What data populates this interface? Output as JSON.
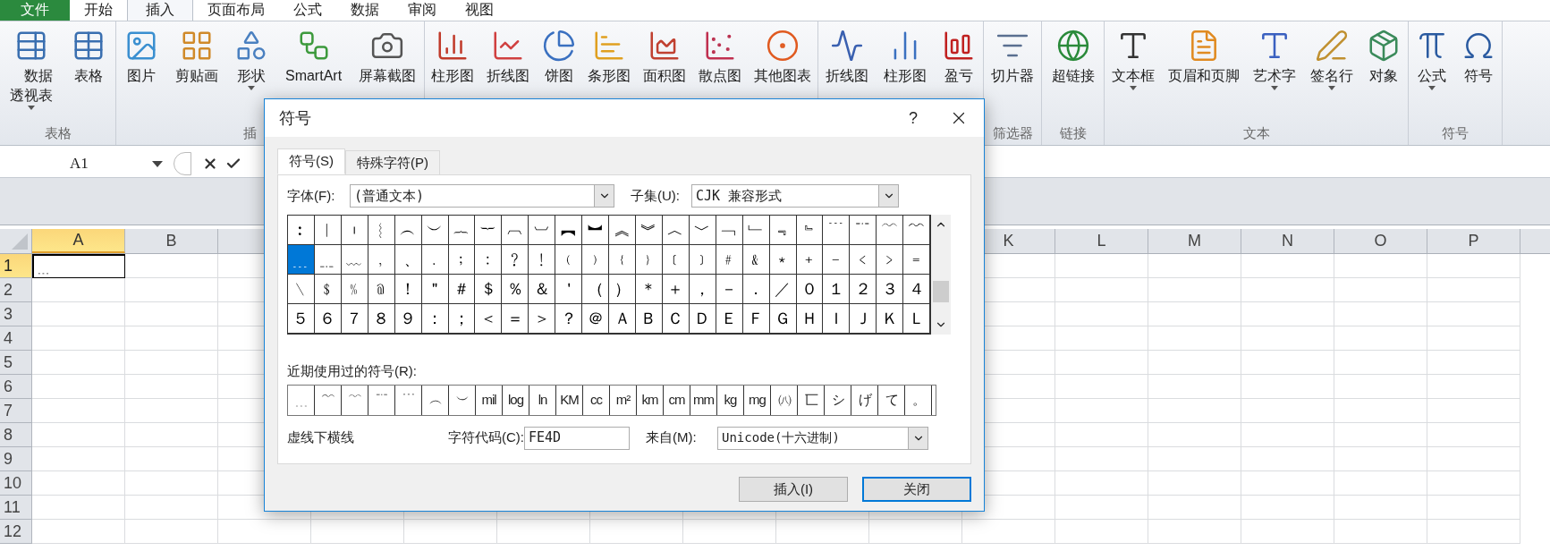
{
  "ribbon_tabs": [
    {
      "label": "文件",
      "kind": "file",
      "selected": false
    },
    {
      "label": "开始",
      "kind": "tab",
      "selected": false
    },
    {
      "label": "插入",
      "kind": "tab",
      "selected": true
    },
    {
      "label": "页面布局",
      "kind": "tab",
      "selected": false
    },
    {
      "label": "公式",
      "kind": "tab",
      "selected": false
    },
    {
      "label": "数据",
      "kind": "tab",
      "selected": false
    },
    {
      "label": "审阅",
      "kind": "tab",
      "selected": false
    },
    {
      "label": "视图",
      "kind": "tab",
      "selected": false
    }
  ],
  "ribbon_groups": [
    {
      "label": "表格",
      "items": [
        {
          "label": "数据透视表",
          "dropdown": true
        },
        {
          "label": "表格",
          "dropdown": false
        }
      ]
    },
    {
      "label": "插",
      "items": [
        {
          "label": "图片",
          "dropdown": false
        },
        {
          "label": "剪贴画",
          "dropdown": false
        },
        {
          "label": "形状",
          "dropdown": true
        },
        {
          "label": "SmartArt",
          "dropdown": false
        },
        {
          "label": "屏幕截图",
          "dropdown": false
        }
      ]
    },
    {
      "items": [
        {
          "label": "柱形图",
          "dropdown": false
        },
        {
          "label": "折线图",
          "dropdown": false
        },
        {
          "label": "饼图",
          "dropdown": false
        },
        {
          "label": "条形图",
          "dropdown": false
        },
        {
          "label": "面积图",
          "dropdown": false
        },
        {
          "label": "散点图",
          "dropdown": false
        },
        {
          "label": "其他图表",
          "dropdown": false
        }
      ]
    },
    {
      "items": [
        {
          "label": "折线图",
          "dropdown": false
        },
        {
          "label": "柱形图",
          "dropdown": false
        },
        {
          "label": "盈亏",
          "dropdown": false
        }
      ]
    },
    {
      "label": "筛选器",
      "items": [
        {
          "label": "切片器",
          "dropdown": false
        }
      ]
    },
    {
      "label": "链接",
      "items": [
        {
          "label": "超链接",
          "dropdown": false
        }
      ]
    },
    {
      "label": "文本",
      "items": [
        {
          "label": "文本框",
          "dropdown": true
        },
        {
          "label": "页眉和页脚",
          "dropdown": false
        },
        {
          "label": "艺术字",
          "dropdown": true
        },
        {
          "label": "签名行",
          "dropdown": true
        },
        {
          "label": "对象",
          "dropdown": false
        }
      ]
    },
    {
      "label": "符号",
      "items": [
        {
          "label": "公式",
          "dropdown": true
        },
        {
          "label": "符号",
          "dropdown": false
        }
      ]
    }
  ],
  "name_box": "A1",
  "sheet": {
    "columns_left": [
      {
        "label": "A",
        "selected": true
      },
      {
        "label": "B",
        "selected": false
      }
    ],
    "columns_right": [
      {
        "label": "K",
        "selected": false
      },
      {
        "label": "L",
        "selected": false
      },
      {
        "label": "M",
        "selected": false
      },
      {
        "label": "N",
        "selected": false
      },
      {
        "label": "O",
        "selected": false
      },
      {
        "label": "P",
        "selected": false
      }
    ],
    "rows": [
      {
        "label": "1",
        "selected": true,
        "cell_a": "﹍"
      },
      {
        "label": "2",
        "selected": false
      },
      {
        "label": "3",
        "selected": false
      },
      {
        "label": "4",
        "selected": false
      },
      {
        "label": "5",
        "selected": false
      },
      {
        "label": "6",
        "selected": false
      },
      {
        "label": "7",
        "selected": false
      },
      {
        "label": "8",
        "selected": false
      },
      {
        "label": "9",
        "selected": false
      },
      {
        "label": "10",
        "selected": false
      },
      {
        "label": "11",
        "selected": false
      },
      {
        "label": "12",
        "selected": false
      }
    ]
  },
  "dialog": {
    "title": "符号",
    "help": "?",
    "tabs": [
      {
        "label": "符号(S)",
        "selected": true
      },
      {
        "label": "特殊字符(P)",
        "selected": false
      }
    ],
    "font_label": "字体(F):",
    "font_value": "(普通文本)",
    "subset_label": "子集(U):",
    "subset_value": "CJK 兼容形式",
    "symbol_rows": [
      [
        {
          "char": "︰",
          "selected": false
        },
        {
          "char": "︱",
          "selected": false
        },
        {
          "char": "︲",
          "selected": false
        },
        {
          "char": "︴",
          "selected": false
        },
        {
          "char": "︵",
          "selected": false
        },
        {
          "char": "︶",
          "selected": false
        },
        {
          "char": "︷",
          "selected": false
        },
        {
          "char": "︸",
          "selected": false
        },
        {
          "char": "︹",
          "selected": false
        },
        {
          "char": "︺",
          "selected": false
        },
        {
          "char": "︻",
          "selected": false
        },
        {
          "char": "︼",
          "selected": false
        },
        {
          "char": "︽",
          "selected": false
        },
        {
          "char": "︾",
          "selected": false
        },
        {
          "char": "︿",
          "selected": false
        },
        {
          "char": "﹀",
          "selected": false
        },
        {
          "char": "﹁",
          "selected": false
        },
        {
          "char": "﹂",
          "selected": false
        },
        {
          "char": "﹃",
          "selected": false
        },
        {
          "char": "﹄",
          "selected": false
        },
        {
          "char": "﹉",
          "selected": false
        },
        {
          "char": "﹊",
          "selected": false
        },
        {
          "char": "﹋",
          "selected": false
        },
        {
          "char": "﹌",
          "selected": false
        }
      ],
      [
        {
          "char": "﹍",
          "selected": true
        },
        {
          "char": "﹎",
          "selected": false
        },
        {
          "char": "﹏",
          "selected": false
        },
        {
          "char": "﹐",
          "selected": false
        },
        {
          "char": "﹑",
          "selected": false
        },
        {
          "char": "﹒",
          "selected": false
        },
        {
          "char": "﹔",
          "selected": false
        },
        {
          "char": "﹕",
          "selected": false
        },
        {
          "char": "﹖",
          "selected": false
        },
        {
          "char": "﹗",
          "selected": false
        },
        {
          "char": "﹙",
          "selected": false
        },
        {
          "char": "﹚",
          "selected": false
        },
        {
          "char": "﹛",
          "selected": false
        },
        {
          "char": "﹜",
          "selected": false
        },
        {
          "char": "﹝",
          "selected": false
        },
        {
          "char": "﹞",
          "selected": false
        },
        {
          "char": "﹟",
          "selected": false
        },
        {
          "char": "﹠",
          "selected": false
        },
        {
          "char": "﹡",
          "selected": false
        },
        {
          "char": "﹢",
          "selected": false
        },
        {
          "char": "﹣",
          "selected": false
        },
        {
          "char": "﹤",
          "selected": false
        },
        {
          "char": "﹥",
          "selected": false
        },
        {
          "char": "﹦",
          "selected": false
        }
      ],
      [
        {
          "char": "﹨",
          "selected": false
        },
        {
          "char": "﹩",
          "selected": false
        },
        {
          "char": "﹪",
          "selected": false
        },
        {
          "char": "﹫",
          "selected": false
        },
        {
          "char": "！",
          "selected": false
        },
        {
          "char": "＂",
          "selected": false
        },
        {
          "char": "＃",
          "selected": false
        },
        {
          "char": "＄",
          "selected": false
        },
        {
          "char": "％",
          "selected": false
        },
        {
          "char": "＆",
          "selected": false
        },
        {
          "char": "＇",
          "selected": false
        },
        {
          "char": "（",
          "selected": false
        },
        {
          "char": "）",
          "selected": false
        },
        {
          "char": "＊",
          "selected": false
        },
        {
          "char": "＋",
          "selected": false
        },
        {
          "char": "，",
          "selected": false
        },
        {
          "char": "－",
          "selected": false
        },
        {
          "char": "．",
          "selected": false
        },
        {
          "char": "／",
          "selected": false
        },
        {
          "char": "０",
          "selected": false
        },
        {
          "char": "１",
          "selected": false
        },
        {
          "char": "２",
          "selected": false
        },
        {
          "char": "３",
          "selected": false
        },
        {
          "char": "４",
          "selected": false
        }
      ],
      [
        {
          "char": "５",
          "selected": false
        },
        {
          "char": "６",
          "selected": false
        },
        {
          "char": "７",
          "selected": false
        },
        {
          "char": "８",
          "selected": false
        },
        {
          "char": "９",
          "selected": false
        },
        {
          "char": "：",
          "selected": false
        },
        {
          "char": "；",
          "selected": false
        },
        {
          "char": "＜",
          "selected": false
        },
        {
          "char": "＝",
          "selected": false
        },
        {
          "char": "＞",
          "selected": false
        },
        {
          "char": "？",
          "selected": false
        },
        {
          "char": "＠",
          "selected": false
        },
        {
          "char": "Ａ",
          "selected": false
        },
        {
          "char": "Ｂ",
          "selected": false
        },
        {
          "char": "Ｃ",
          "selected": false
        },
        {
          "char": "Ｄ",
          "selected": false
        },
        {
          "char": "Ｅ",
          "selected": false
        },
        {
          "char": "Ｆ",
          "selected": false
        },
        {
          "char": "Ｇ",
          "selected": false
        },
        {
          "char": "Ｈ",
          "selected": false
        },
        {
          "char": "Ｉ",
          "selected": false
        },
        {
          "char": "Ｊ",
          "selected": false
        },
        {
          "char": "Ｋ",
          "selected": false
        },
        {
          "char": "Ｌ",
          "selected": false
        }
      ]
    ],
    "recent_label": "近期使用过的符号(R):",
    "recent": [
      "﹍",
      "﹌",
      "﹋",
      "﹊",
      "﹉",
      "︵",
      "︶",
      "mil",
      "log",
      "ln",
      "KM",
      "cc",
      "m²",
      "km",
      "cm",
      "mm",
      "kg",
      "mg",
      "㈧",
      "匸",
      "シ",
      "げ",
      "て",
      "。"
    ],
    "description": "虚线下横线",
    "code_label": "字符代码(C):",
    "code_value": "FE4D",
    "from_label": "来自(M):",
    "from_value": "Unicode(十六进制)",
    "buttons": [
      {
        "label": "插入(I)",
        "default": false
      },
      {
        "label": "关闭",
        "default": true
      }
    ]
  }
}
